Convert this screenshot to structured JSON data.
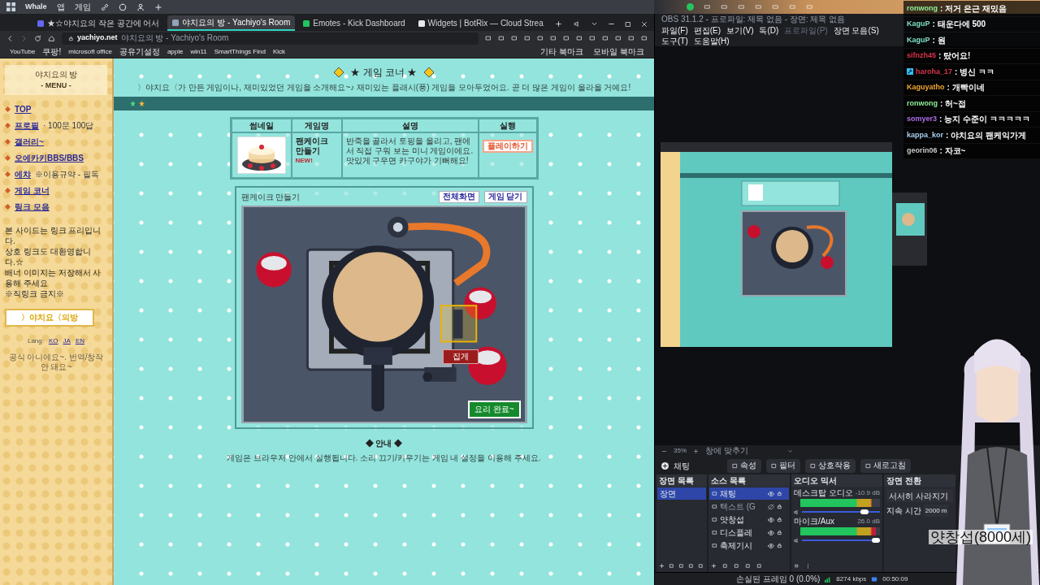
{
  "taskbar": {
    "app": "Whale",
    "items": [
      "앱",
      "게임"
    ]
  },
  "browser": {
    "tabs": [
      {
        "title": "★☆야치요의 작은 공간에 어서",
        "selected": false
      },
      {
        "title": "야치요의 방 - Yachiyo's Room",
        "selected": true
      },
      {
        "title": "Emotes - Kick Dashboard",
        "selected": false
      },
      {
        "title": "Widgets | BotRix — Cloud Strea",
        "selected": false
      }
    ],
    "address": {
      "domain": "yachiyo.net",
      "page_title": "야치요의 방 - Yachiyo's Room"
    },
    "bookmarks": [
      "YouTube",
      "쿠팡!",
      "microsoft office",
      "공유기설정",
      "apple",
      "win11",
      "SmartThings Find",
      "Kick"
    ],
    "bookmark_folders": [
      "기타 북마크",
      "모바일 북마크"
    ]
  },
  "sidebar": {
    "title": "야치요의 방",
    "subtitle": "- MENU -",
    "menu": [
      {
        "label": "TOP"
      },
      {
        "label": "프로필",
        "note": "· 100문 100답"
      },
      {
        "label": "갤러리~"
      },
      {
        "label": "오에카키BBS/BBS"
      },
      {
        "label": "에챠",
        "note": "※이용규약 - 필독"
      },
      {
        "label": "게임 코너"
      },
      {
        "label": "링크 모음"
      }
    ],
    "notice": [
      "본 사이드는 링크 프리입니다.",
      "상호 링크도 대환영합니다.☆",
      "배너 이미지는 저장해서 사용해 주세요",
      "※직링크 금지※"
    ],
    "banner": "〉야치요〈의방",
    "lang_label": "Lang:",
    "langs": [
      "KO",
      "JA",
      "EN"
    ],
    "footer": "공식 아니에요~. 번역/창작 안 돼요~"
  },
  "main": {
    "title": "★ 게임 코너 ★",
    "subtitle": "〉야치요〈가 만든 게임이나, 재미있었던 게임을 소개해요~♪ 재미있는 플래시(풍) 게임을 모아두었어요. 곧 더 많은 게임이 올라올 거예요!",
    "table": {
      "columns": [
        "썸네일",
        "게임명",
        "설명",
        "실행"
      ],
      "rows": [
        {
          "name": "팬케이크 만들기",
          "badge": "NEW!",
          "description": "반죽을 골라서 토핑을 올리고, 팬에서 직접 구워 보는 미니 게임이에요. 맛있게 구우면 카구야가 기뻐해요!",
          "action": "플레이하기"
        }
      ]
    },
    "game": {
      "title": "팬케이크 만들기",
      "buttons": [
        "전체화면",
        "게임 닫기"
      ],
      "tool_label": "집게",
      "done_button": "요리 완료~"
    },
    "guide_title": "◆ 안내 ◆",
    "guide_text": "게임은 브라우저 안에서 실행됩니다. 소리 끄기/키우기는 게임 내 설정을 이용해 주세요."
  },
  "obs": {
    "title": "OBS 31.1.2 - 프로파일: 제목 없음 - 장면: 제목 없음",
    "menu": [
      {
        "label": "파일(F)",
        "disabled": false
      },
      {
        "label": "편집(E)",
        "disabled": false
      },
      {
        "label": "보기(V)",
        "disabled": false
      },
      {
        "label": "독(D)",
        "disabled": false
      },
      {
        "label": "프로파일(P)",
        "disabled": true
      },
      {
        "label": "장면 모음(S)",
        "disabled": false
      },
      {
        "label": "도구(T)",
        "disabled": false
      },
      {
        "label": "도움말(H)",
        "disabled": false
      }
    ],
    "zoom": "35%",
    "fit": "창에 맞추기",
    "source_name": "채팅",
    "tools": [
      "속성",
      "필터",
      "상호작용",
      "새로고침"
    ],
    "scenes_title": "장면 목록",
    "scenes": [
      {
        "name": "장면",
        "selected": true
      }
    ],
    "sources_title": "소스 목록",
    "sources": [
      {
        "name": "채팅",
        "visible": true,
        "selected": true
      },
      {
        "name": "텍스트 (G",
        "visible": false,
        "selected": false
      },
      {
        "name": "얏창섭",
        "visible": true,
        "selected": false
      },
      {
        "name": "디스플레",
        "visible": true,
        "selected": false
      },
      {
        "name": "축제기시",
        "visible": true,
        "selected": false
      }
    ],
    "mixer_title": "오디오 믹서",
    "channels": [
      {
        "name": "데스크탑 오디오",
        "reading": "-10.9 dB",
        "level": 0.9,
        "volume": {
          "level": 0.85
        }
      },
      {
        "name": "마이크/Aux",
        "reading": "26.0 dB",
        "level": 0.95,
        "volume": {
          "level": 1
        }
      }
    ],
    "transitions_title": "장면 전환",
    "transition": "서서히 사라지기",
    "duration_label": "지속 시간",
    "duration": "2000 m",
    "status": {
      "dropped": "손실된 프레임 0 (0.0%)",
      "bitrate": "8274 kbps",
      "time": "00:50:09"
    }
  },
  "chat": [
    {
      "user": "ronwong",
      "color": "#8ef09a",
      "text": ": 저거 은근 재밌음",
      "mod": false
    },
    {
      "user": "KaguP",
      "color": "#7fe0c8",
      "text": ": 태운다에 500",
      "mod": false
    },
    {
      "user": "KaguP",
      "color": "#7fe0c8",
      "text": ": 원",
      "mod": false
    },
    {
      "user": "sifnzh45",
      "color": "#d6334a",
      "text": ": 탔어요!",
      "mod": false
    },
    {
      "user": "haroha_17",
      "color": "#d6334a",
      "text": ": 병신 ㅋㅋ",
      "mod": true
    },
    {
      "user": "Kaguyatho",
      "color": "#f0a830",
      "text": ": 개빡이네",
      "mod": false
    },
    {
      "user": "ronwong",
      "color": "#8ef09a",
      "text": ": 허~접",
      "mod": false
    },
    {
      "user": "somyer3",
      "color": "#b06ee8",
      "text": ": 능지 수준이 ㅋㅋㅋㅋㅋ",
      "mod": false
    },
    {
      "user": "kappa_kor",
      "color": "#a8d0f0",
      "text": ": 야치요의 팬케익가게",
      "mod": false
    },
    {
      "user": "georin06",
      "color": "#c8c8c8",
      "text": ": 자코~",
      "mod": false
    }
  ],
  "avatar_caption": "얏창섭(8000세)"
}
